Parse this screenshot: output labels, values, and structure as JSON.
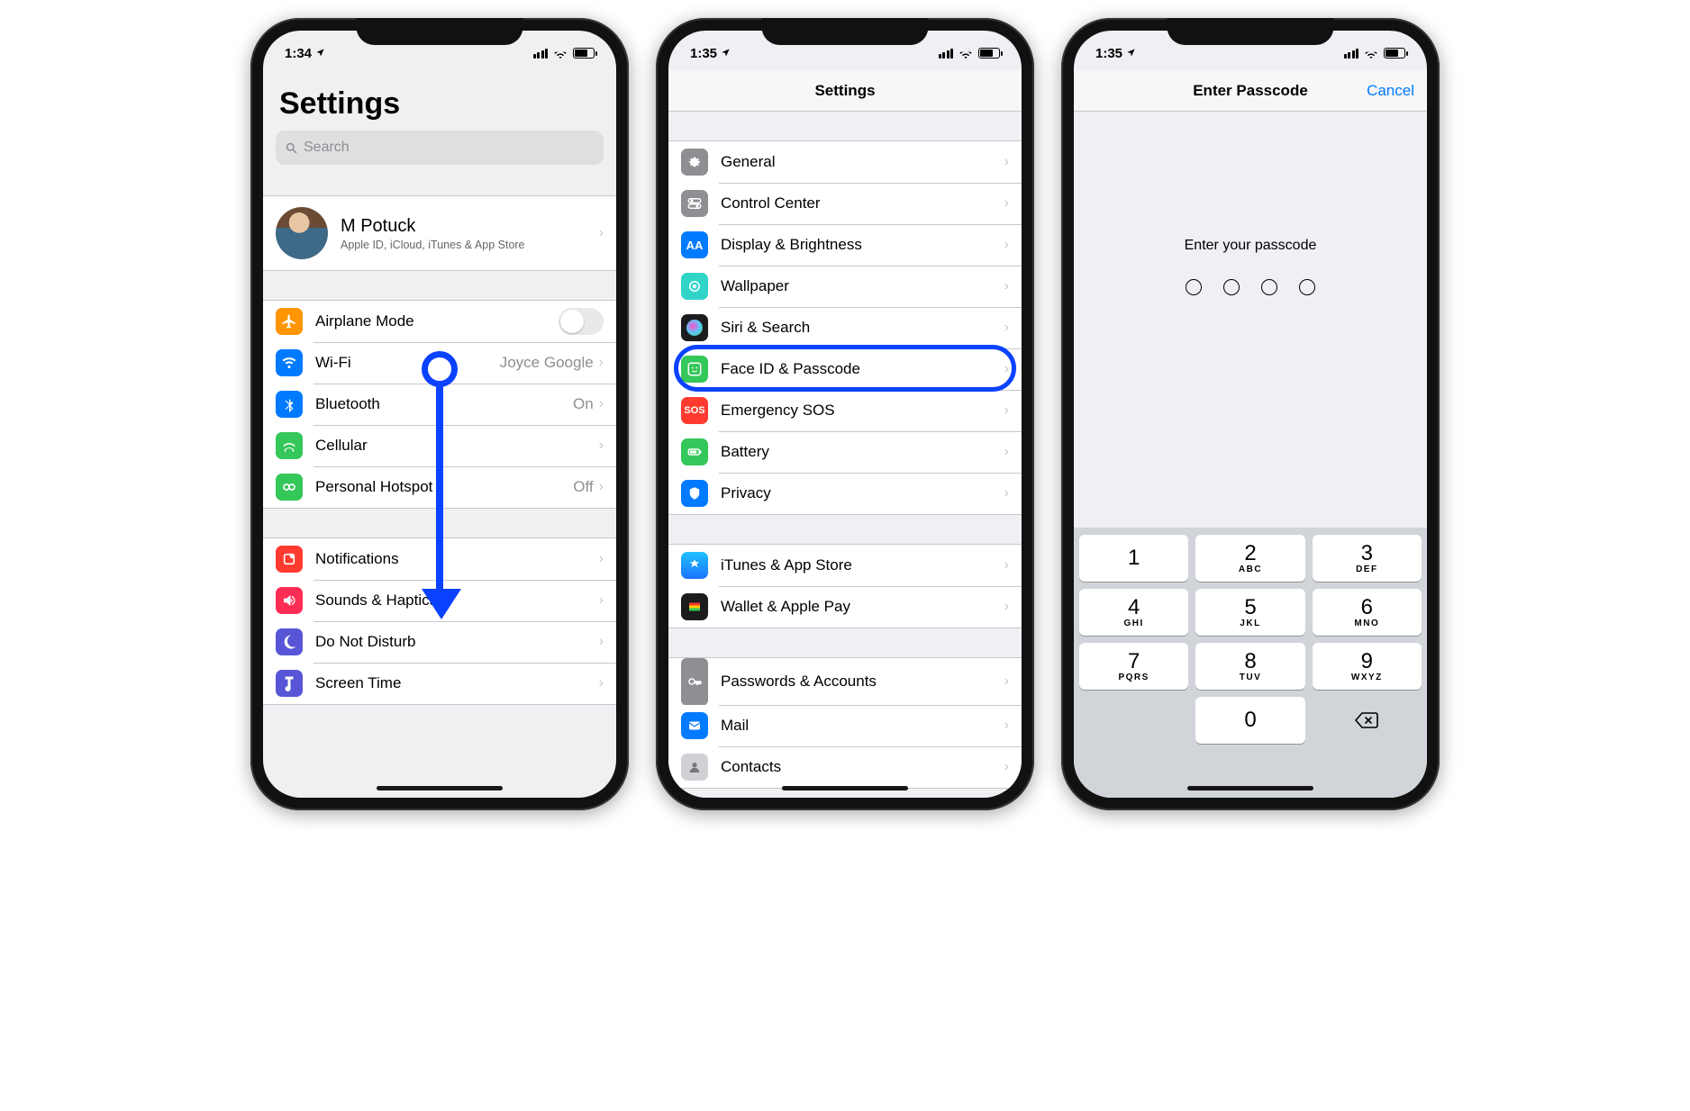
{
  "status": {
    "time1": "1:34",
    "time2": "1:35",
    "time3": "1:35"
  },
  "screen1": {
    "title": "Settings",
    "searchPlaceholder": "Search",
    "account": {
      "name": "M Potuck",
      "sub": "Apple ID, iCloud, iTunes & App Store"
    },
    "rows": {
      "airplane": "Airplane Mode",
      "wifi": "Wi-Fi",
      "wifiValue": "Joyce Google",
      "bluetooth": "Bluetooth",
      "bluetoothValue": "On",
      "cellular": "Cellular",
      "hotspot": "Personal Hotspot",
      "hotspotValue": "Off",
      "notifications": "Notifications",
      "sounds": "Sounds & Haptics",
      "dnd": "Do Not Disturb",
      "screentime": "Screen Time"
    }
  },
  "screen2": {
    "title": "Settings",
    "rows": {
      "general": "General",
      "controlcenter": "Control Center",
      "display": "Display & Brightness",
      "wallpaper": "Wallpaper",
      "siri": "Siri & Search",
      "faceid": "Face ID & Passcode",
      "emergency": "Emergency SOS",
      "emergencyIcon": "SOS",
      "battery": "Battery",
      "privacy": "Privacy",
      "itunes": "iTunes & App Store",
      "wallet": "Wallet & Apple Pay",
      "passwords": "Passwords & Accounts",
      "mail": "Mail",
      "contacts": "Contacts"
    }
  },
  "screen3": {
    "title": "Enter Passcode",
    "cancel": "Cancel",
    "prompt": "Enter your passcode",
    "keys": [
      {
        "n": "1",
        "s": ""
      },
      {
        "n": "2",
        "s": "ABC"
      },
      {
        "n": "3",
        "s": "DEF"
      },
      {
        "n": "4",
        "s": "GHI"
      },
      {
        "n": "5",
        "s": "JKL"
      },
      {
        "n": "6",
        "s": "MNO"
      },
      {
        "n": "7",
        "s": "PQRS"
      },
      {
        "n": "8",
        "s": "TUV"
      },
      {
        "n": "9",
        "s": "WXYZ"
      },
      {
        "n": "0",
        "s": ""
      }
    ]
  }
}
